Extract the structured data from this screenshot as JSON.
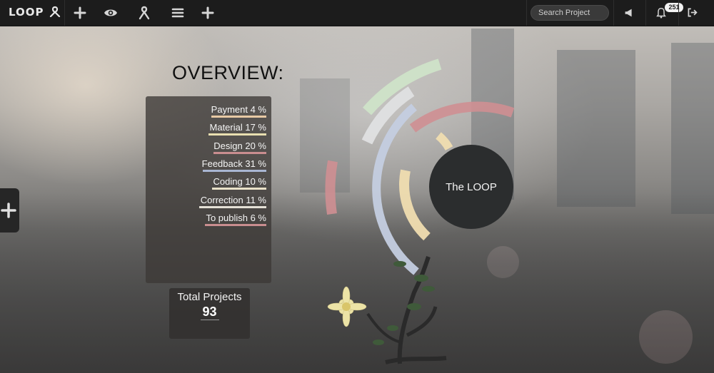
{
  "app": {
    "logo": "LOOP"
  },
  "nav": {
    "search_placeholder": "Search Project",
    "notification_count": "251"
  },
  "overview": {
    "title": "OVERVIEW:",
    "stats": [
      {
        "label": "Payment 4 %",
        "color": "#e7c9a4",
        "line_width": 77
      },
      {
        "label": "Material 17 %",
        "color": "#e9dfb0",
        "line_width": 81
      },
      {
        "label": "Design 20 %",
        "color": "#c98e90",
        "line_width": 74
      },
      {
        "label": "Feedback 31 %",
        "color": "#a9b6d2",
        "line_width": 89
      },
      {
        "label": "Coding 10 %",
        "color": "#e9e1c8",
        "line_width": 76
      },
      {
        "label": "Correction 11 %",
        "color": "#e4e0d6",
        "line_width": 94
      },
      {
        "label": "To publish 6 %",
        "color": "#c98e90",
        "line_width": 86
      }
    ],
    "total_label": "Total Projects",
    "total_value": "93"
  },
  "loop": {
    "center_label": "The LOOP",
    "colors": {
      "green": "#cfe3c8",
      "pink": "#cf8f92",
      "blue": "#c4cee0",
      "yellow": "#f0ddb0",
      "gray": "#dfe0e2"
    }
  }
}
